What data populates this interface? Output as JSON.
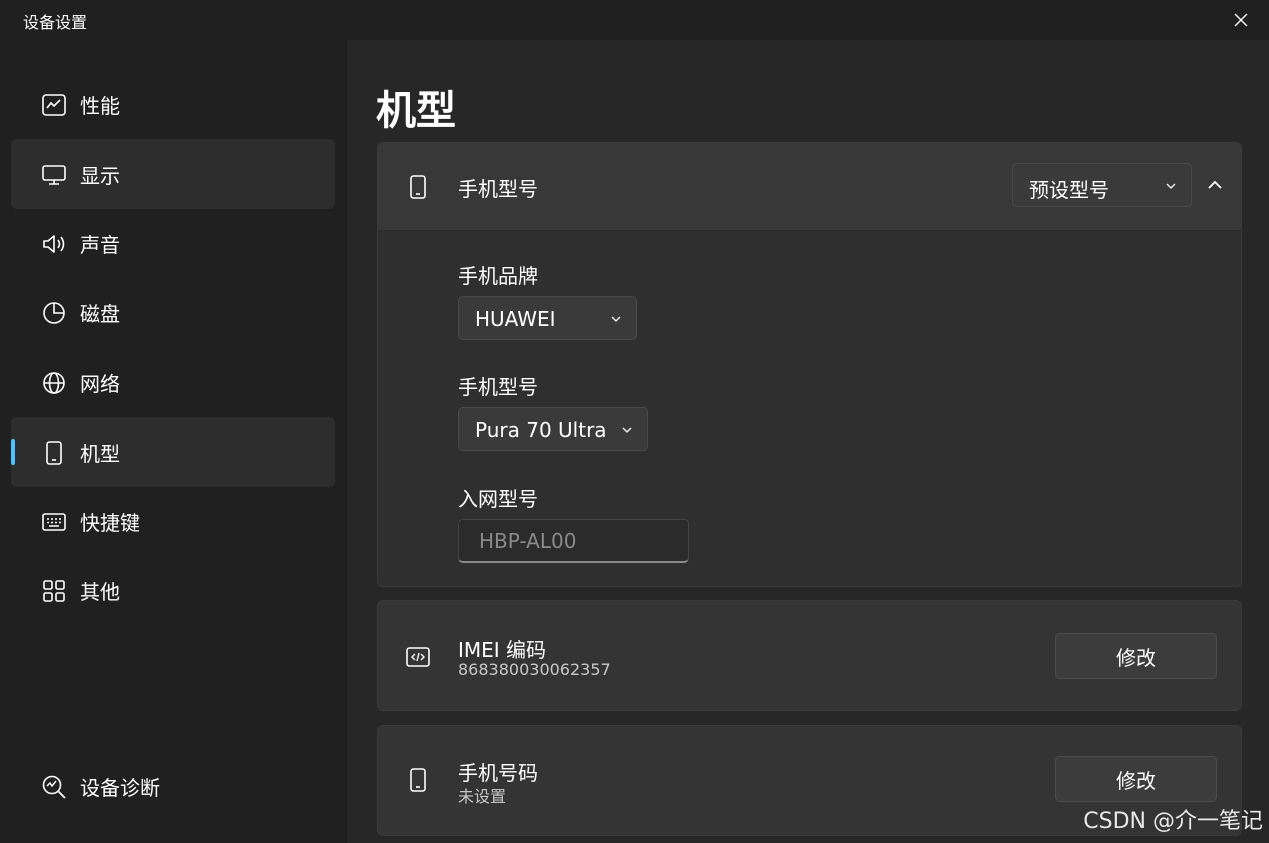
{
  "window": {
    "title": "设备设置"
  },
  "sidebar": {
    "items": [
      {
        "label": "性能",
        "icon": "performance-chart-icon"
      },
      {
        "label": "显示",
        "icon": "monitor-icon"
      },
      {
        "label": "声音",
        "icon": "speaker-icon"
      },
      {
        "label": "磁盘",
        "icon": "pie-chart-icon"
      },
      {
        "label": "网络",
        "icon": "globe-icon"
      },
      {
        "label": "机型",
        "icon": "phone-icon",
        "active": true
      },
      {
        "label": "快捷键",
        "icon": "keyboard-icon"
      },
      {
        "label": "其他",
        "icon": "grid-icon"
      }
    ],
    "footer": {
      "label": "设备诊断",
      "icon": "diagnostics-icon"
    }
  },
  "main": {
    "title": "机型",
    "model_card": {
      "title": "手机型号",
      "preset_dropdown": "预设型号",
      "brand_label": "手机品牌",
      "brand_value": "HUAWEI",
      "model_label": "手机型号",
      "model_value": "Pura 70 Ultra",
      "network_label": "入网型号",
      "network_placeholder": "HBP-AL00"
    },
    "imei_card": {
      "title": "IMEI 编码",
      "value": "868380030062357",
      "button": "修改"
    },
    "phone_card": {
      "title": "手机号码",
      "value": "未设置",
      "button": "修改"
    }
  },
  "watermark": "CSDN @介一笔记",
  "colors": {
    "accent": "#4cc2ff",
    "background": "#202020",
    "pane": "#272727"
  }
}
